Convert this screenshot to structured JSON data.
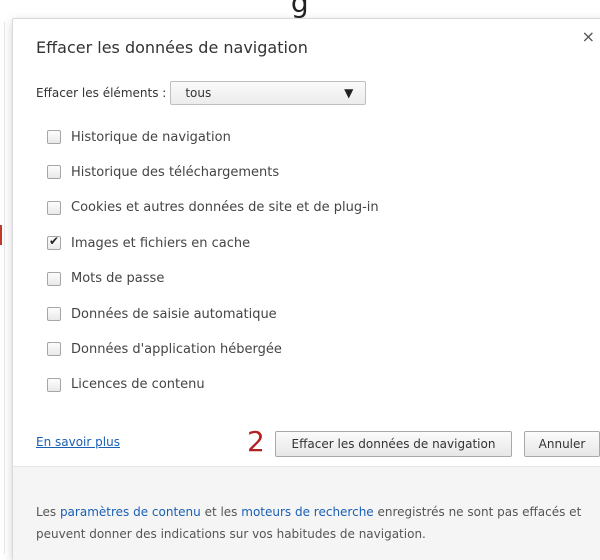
{
  "background": {
    "heading": "g"
  },
  "dialog": {
    "title": "Effacer les données de navigation",
    "close_glyph": "×",
    "select_label": "Effacer les éléments :",
    "select_value": "tous",
    "options": [
      {
        "label": "Historique de navigation",
        "checked": false
      },
      {
        "label": "Historique des téléchargements",
        "checked": false
      },
      {
        "label": "Cookies et autres données de site et de plug-in",
        "checked": false
      },
      {
        "label": "Images et fichiers en cache",
        "checked": true
      },
      {
        "label": "Mots de passe",
        "checked": false
      },
      {
        "label": "Données de saisie automatique",
        "checked": false
      },
      {
        "label": "Données d'application hébergée",
        "checked": false
      },
      {
        "label": "Licences de contenu",
        "checked": false
      }
    ],
    "learn_more": "En savoir plus",
    "annotation": "2",
    "clear_button": "Effacer les données de navigation",
    "cancel_button": "Annuler",
    "info": {
      "prefix": "Les ",
      "link1": "paramètres de contenu",
      "middle": " et les ",
      "link2": "moteurs de recherche",
      "suffix": " enregistrés ne sont pas effacés et peuvent donner des indications sur vos habitudes de navigation."
    }
  },
  "colors": {
    "link": "#1a5fb4",
    "annotation": "#b22222"
  }
}
